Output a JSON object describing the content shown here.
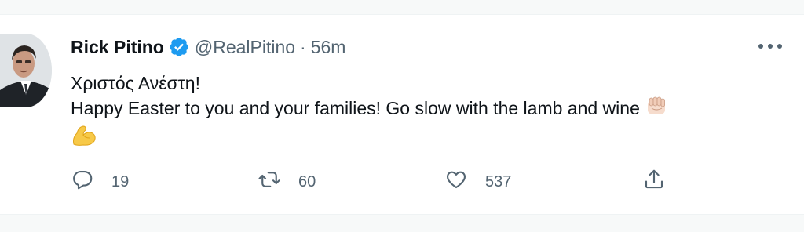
{
  "tweet": {
    "name": "Rick Pitino",
    "handle": "@RealPitino",
    "separator": "·",
    "time": "56m",
    "text_line1": "Χριστός Ανέστη!",
    "text_line2": "Happy Easter to you and your families! Go slow with the lamb and wine",
    "emojis": [
      "fist-emoji",
      "flexed-biceps-emoji"
    ]
  },
  "actions": {
    "replies": "19",
    "retweets": "60",
    "likes": "537"
  },
  "colors": {
    "verified": "#1d9bf0",
    "muted": "#536471",
    "text": "#0f1419",
    "background": "#f7f9f9"
  }
}
